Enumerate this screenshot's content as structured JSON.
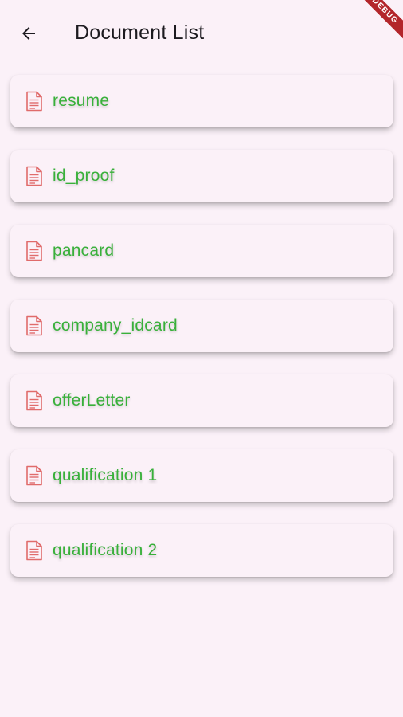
{
  "app_bar": {
    "title": "Document List",
    "back_icon": "arrow-left-icon"
  },
  "debug_banner": {
    "label": "DEBUG"
  },
  "documents": [
    {
      "name": "resume",
      "icon": "file-document-icon"
    },
    {
      "name": "id_proof",
      "icon": "file-document-icon"
    },
    {
      "name": "pancard",
      "icon": "file-document-icon"
    },
    {
      "name": "company_idcard",
      "icon": "file-document-icon"
    },
    {
      "name": "offerLetter",
      "icon": "file-document-icon"
    },
    {
      "name": "qualification 1",
      "icon": "file-document-icon"
    },
    {
      "name": "qualification 2",
      "icon": "file-document-icon"
    }
  ],
  "colors": {
    "background": "#fbf1f8",
    "label_green": "#38b03a",
    "icon_red": "#e06b6b",
    "banner_red": "#b3262b"
  }
}
